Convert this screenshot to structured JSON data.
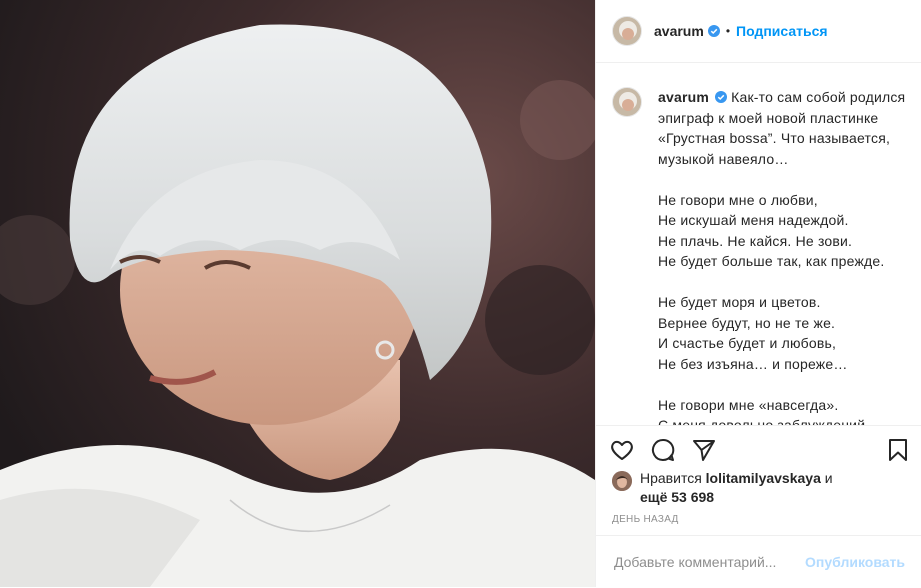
{
  "post": {
    "username": "avarum",
    "follow_label": "Подписаться",
    "dot": "•",
    "caption": "Как-то сам собой родился эпиграф к моей новой пластинке «Грустная bossa”. Что называется, музыкой навеяло…\n\nНе говори мне о любви,\nНе искушай меня надеждой.\nНе плачь. Не кайся. Не зови.\nНе будет больше так, как прежде.\n\nНе будет моря и цветов.\nВернее будут, но не те же.\nИ счастье будет и любовь,\nНе без изъяна… и пореже…\n\nНе говори мне «навсегда».\nС меня довольно заблуждений.\nСлова пусты. Слова - вода.\nВ них смысла нет и нет спасений.",
    "likes_prefix": "Нравится",
    "likes_user": "lolitamilyavskaya",
    "likes_and": "и",
    "likes_more": "ещё 53 698",
    "time": "День назад"
  },
  "comment": {
    "placeholder": "Добавьте комментарий...",
    "publish_label": "Опубликовать"
  },
  "icons": {
    "like": "heart-icon",
    "comment": "comment-icon",
    "share": "paper-plane-icon",
    "save": "bookmark-icon",
    "verified": "verified-badge-icon"
  },
  "colors": {
    "accent": "#0095f6",
    "publish_disabled": "#b3dbff",
    "muted": "#8e8e8e"
  }
}
